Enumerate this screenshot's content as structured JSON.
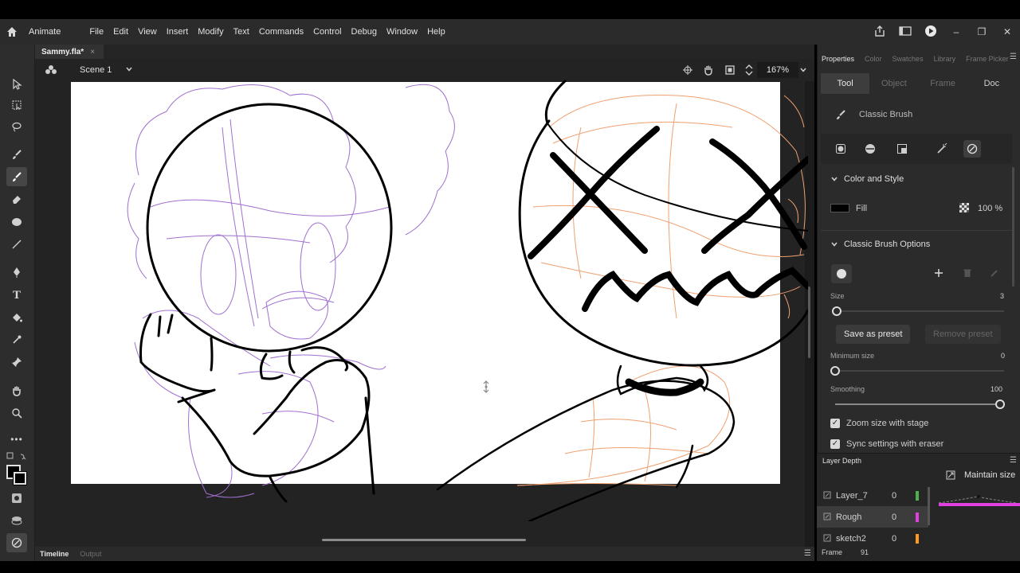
{
  "app": {
    "name": "Animate",
    "menu": [
      "File",
      "Edit",
      "View",
      "Insert",
      "Modify",
      "Text",
      "Commands",
      "Control",
      "Debug",
      "Window",
      "Help"
    ]
  },
  "document": {
    "tab_name": "Sammy.fla*",
    "tab_close": "×",
    "scene": "Scene 1",
    "zoom": "167%"
  },
  "bottom_tabs": {
    "timeline": "Timeline",
    "output": "Output"
  },
  "properties": {
    "panel_tabs": [
      "Properties",
      "Color",
      "Swatches",
      "Library",
      "Frame Picker"
    ],
    "active_panel_tab": "Properties",
    "sub_tabs": [
      "Tool",
      "Object",
      "Frame",
      "Doc"
    ],
    "active_sub_tab": "Tool",
    "tool_name": "Classic Brush",
    "color_and_style": {
      "header": "Color and Style",
      "fill_label": "Fill",
      "fill_color": "#000000",
      "opacity": "100 %"
    },
    "brush_options": {
      "header": "Classic Brush Options",
      "size_label": "Size",
      "size_value": "3",
      "size_fraction": 0.0,
      "save_preset": "Save as preset",
      "remove_preset": "Remove preset",
      "min_size_label": "Minimum size",
      "min_size_value": "0",
      "min_size_fraction": 0.0,
      "smoothing_label": "Smoothing",
      "smoothing_value": "100",
      "smoothing_fraction": 1.0,
      "zoom_with_stage": "Zoom size with stage",
      "zoom_with_stage_checked": true,
      "sync_with_eraser": "Sync settings with eraser",
      "sync_with_eraser_checked": true
    }
  },
  "layer_depth": {
    "title": "Layer Depth",
    "maintain_size": "Maintain size",
    "layers": [
      {
        "name": "Layer_7",
        "depth": "0",
        "color": "#4caf50"
      },
      {
        "name": "Rough",
        "depth": "0",
        "color": "#e040e0"
      },
      {
        "name": "sketch2",
        "depth": "0",
        "color": "#ff9a1f"
      }
    ],
    "frame_label": "Frame",
    "frame_value": "91"
  },
  "colors": {
    "accent_magenta": "#e040e0",
    "sketch_purple": "#a070d0",
    "sketch_orange": "#f0a070",
    "stroke": "#000000"
  },
  "icons": {
    "home": "home-icon",
    "share": "share-icon",
    "workspace": "workspace-icon",
    "test_movie": "play-icon"
  }
}
